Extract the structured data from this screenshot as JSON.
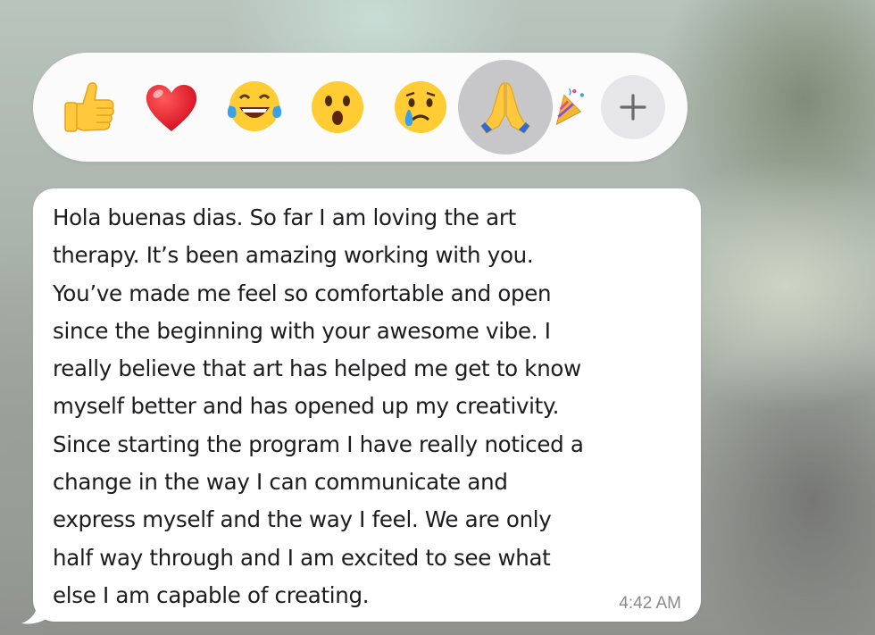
{
  "reactions": [
    {
      "name": "thumbs-up",
      "glyph": "👍"
    },
    {
      "name": "red-heart",
      "glyph": "❤️"
    },
    {
      "name": "tears-of-joy",
      "glyph": "😂"
    },
    {
      "name": "surprised",
      "glyph": "😮"
    },
    {
      "name": "crying",
      "glyph": "😢"
    },
    {
      "name": "folded-hands",
      "glyph": "🙏",
      "selected": true
    },
    {
      "name": "party-popper",
      "glyph": "🎉"
    }
  ],
  "add_reaction": {
    "label": "+"
  },
  "message": {
    "lines": [
      "Hola buenas dias. So far I am loving the art",
      "therapy. It’s been amazing working with you.",
      "You’ve made me feel so comfortable and open",
      "since the beginning with your awesome vibe. I",
      "really believe that art has helped me get to know",
      "myself better and has opened up my creativity.",
      "Since starting the program I have really noticed a",
      "change in the way I can communicate and",
      "express myself and the way I feel. We are only",
      "half way through and I am excited to see what",
      "else I am capable of creating."
    ],
    "timestamp": "4:42 AM"
  },
  "colors": {
    "bubble": "#ffffff",
    "reaction_bar": "#fbfbfb",
    "selected_highlight": "#c7c7c9",
    "text": "#1c1c1e",
    "timestamp": "#8a8a8e"
  }
}
